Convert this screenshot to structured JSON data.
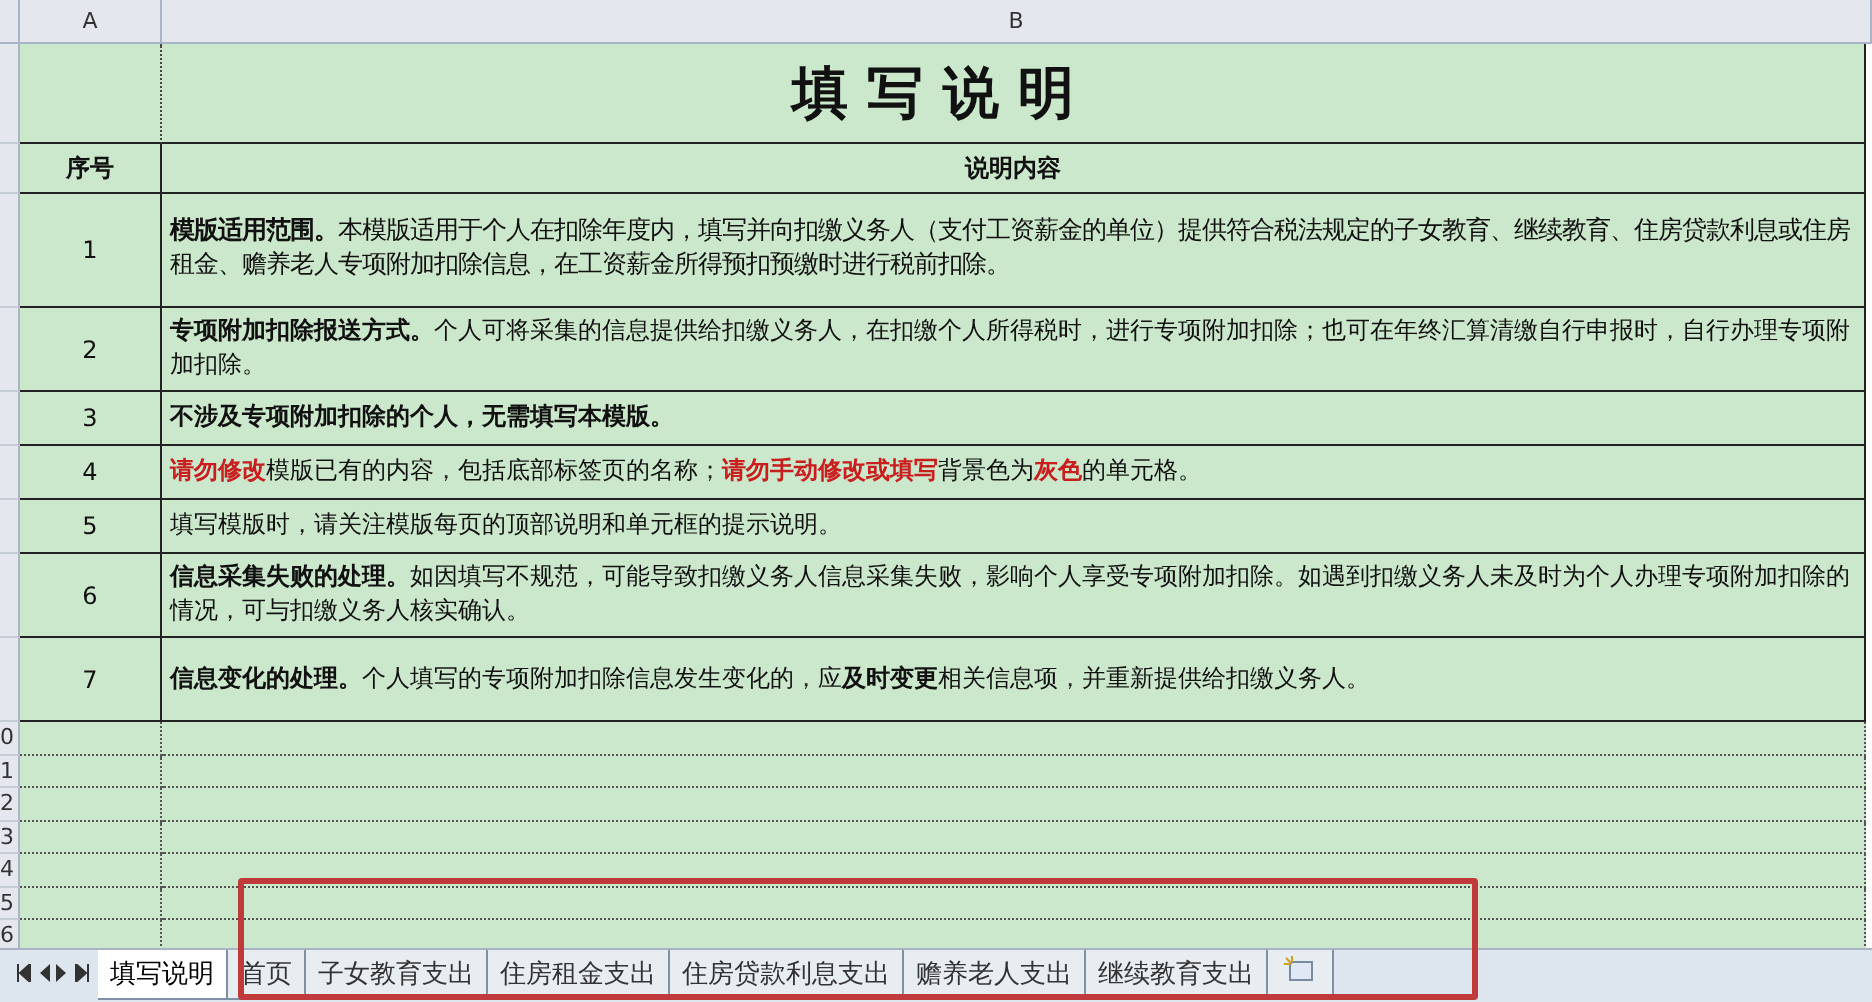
{
  "columns": [
    {
      "label": "A"
    },
    {
      "label": "B"
    }
  ],
  "title": "填 写 说 明",
  "header": {
    "number": "序号",
    "content": "说明内容"
  },
  "rows": [
    {
      "number": "1",
      "parts": [
        {
          "text": "模版适用范围。",
          "kind": "bold"
        },
        {
          "text": "本模版适用于个人在扣除年度内，填写并向扣缴义务人（支付工资薪金的单位）提供符合税法规定的子女教育、继续教育、住房贷款利息或住房租金、赡养老人专项附加扣除信息，在工资薪金所得预扣预缴时进行税前扣除。",
          "kind": "plain"
        }
      ]
    },
    {
      "number": "2",
      "parts": [
        {
          "text": "专项附加扣除报送方式。",
          "kind": "bold"
        },
        {
          "text": "个人可将采集的信息提供给扣缴义务人，在扣缴个人所得税时，进行专项附加扣除；也可在年终汇算清缴自行申报时，自行办理专项附加扣除。",
          "kind": "plain"
        }
      ]
    },
    {
      "number": "3",
      "parts": [
        {
          "text": "不涉及专项附加扣除的个人，无需填写本模版。",
          "kind": "bold"
        }
      ]
    },
    {
      "number": "4",
      "parts": [
        {
          "text": "请勿修改",
          "kind": "alert"
        },
        {
          "text": "模版已有的内容，包括底部标签页的名称；",
          "kind": "plain"
        },
        {
          "text": "请勿手动修改或填写",
          "kind": "alert"
        },
        {
          "text": "背景色为",
          "kind": "plain"
        },
        {
          "text": "灰色",
          "kind": "alert"
        },
        {
          "text": "的单元格。",
          "kind": "plain"
        }
      ]
    },
    {
      "number": "5",
      "parts": [
        {
          "text": "填写模版时，请关注模版每页的顶部说明和单元框的提示说明。",
          "kind": "plain"
        }
      ]
    },
    {
      "number": "6",
      "parts": [
        {
          "text": "信息采集失败的处理。",
          "kind": "bold"
        },
        {
          "text": "如因填写不规范，可能导致扣缴义务人信息采集失败，影响个人享受专项附加扣除。如遇到扣缴义务人未及时为个人办理专项附加扣除的情况，可与扣缴义务人核实确认。",
          "kind": "plain"
        }
      ]
    },
    {
      "number": "7",
      "parts": [
        {
          "text": "信息变化的处理。",
          "kind": "bold"
        },
        {
          "text": "个人填写的专项附加扣除信息发生变化的，应",
          "kind": "plain"
        },
        {
          "text": "及时变更",
          "kind": "bold"
        },
        {
          "text": "相关信息项，并重新提供给扣缴义务人。",
          "kind": "plain"
        }
      ]
    }
  ],
  "empty_rows": [
    {
      "label": "0"
    },
    {
      "label": "1"
    },
    {
      "label": "2"
    },
    {
      "label": "3"
    },
    {
      "label": "4"
    },
    {
      "label": "5"
    },
    {
      "label": "6"
    }
  ],
  "sheet_tabs": [
    {
      "label": "填写说明",
      "selected": true
    },
    {
      "label": "首页",
      "selected": false
    },
    {
      "label": "子女教育支出",
      "selected": false
    },
    {
      "label": "住房租金支出",
      "selected": false
    },
    {
      "label": "住房贷款利息支出",
      "selected": false
    },
    {
      "label": "赡养老人支出",
      "selected": false
    },
    {
      "label": "继续教育支出",
      "selected": false
    }
  ]
}
